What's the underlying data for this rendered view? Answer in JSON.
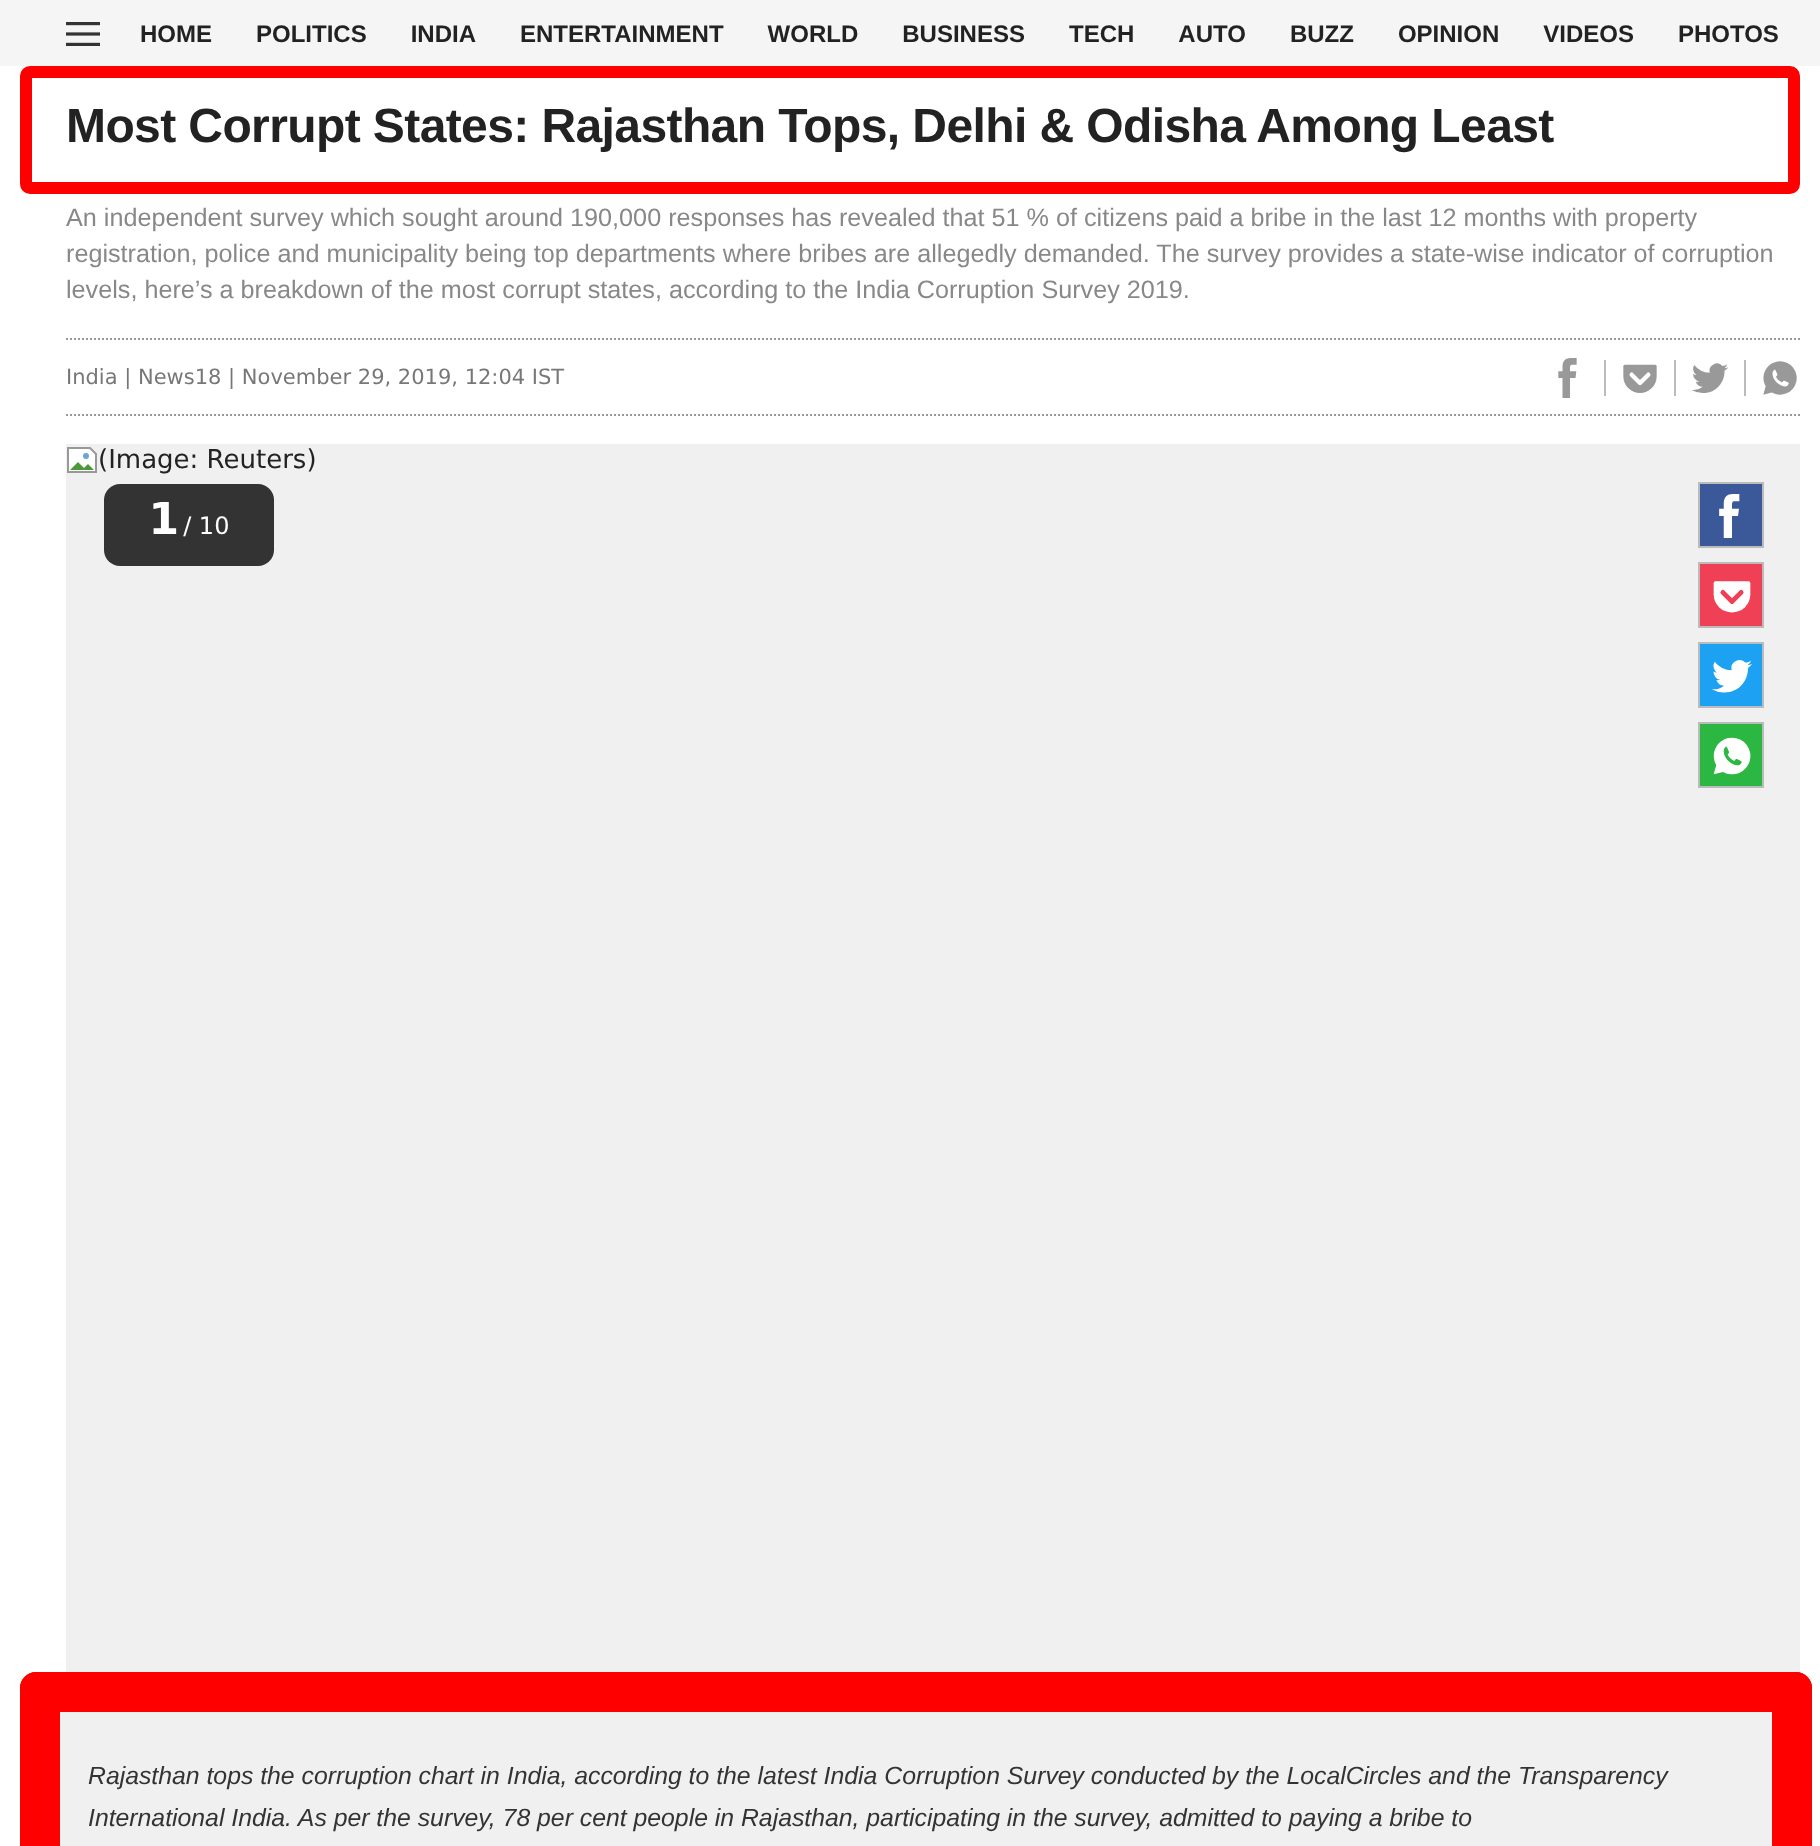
{
  "nav": {
    "items": [
      "HOME",
      "POLITICS",
      "INDIA",
      "ENTERTAINMENT",
      "WORLD",
      "BUSINESS",
      "TECH",
      "AUTO",
      "BUZZ",
      "OPINION",
      "VIDEOS",
      "PHOTOS"
    ]
  },
  "article": {
    "headline": "Most Corrupt States: Rajasthan Tops, Delhi & Odisha Among Least",
    "summary": "An independent survey which sought around 190,000 responses has revealed that 51 % of citizens paid a bribe in the last 12 months with property registration, police and municipality being top departments where bribes are allegedly demanded. The survey provides a state-wise indicator of corruption levels, here’s a breakdown of the most corrupt states, according to the India Corruption Survey 2019.",
    "meta": "India | News18 | November 29, 2019, 12:04 IST",
    "share": [
      {
        "kind": "facebook"
      },
      {
        "kind": "pocket"
      },
      {
        "kind": "twitter"
      },
      {
        "kind": "whatsapp"
      }
    ]
  },
  "gallery": {
    "image_alt": "(Image: Reuters)",
    "counter_current": "1",
    "counter_total": "/ 10",
    "share": [
      {
        "kind": "facebook"
      },
      {
        "kind": "pocket"
      },
      {
        "kind": "twitter"
      },
      {
        "kind": "whatsapp"
      }
    ],
    "caption": "Rajasthan tops the corruption chart in India, according to the latest India Corruption Survey conducted by the LocalCircles and the Transparency International India. As per the survey, 78 per cent people in Rajasthan, participating in the survey, admitted to paying a bribe to"
  }
}
